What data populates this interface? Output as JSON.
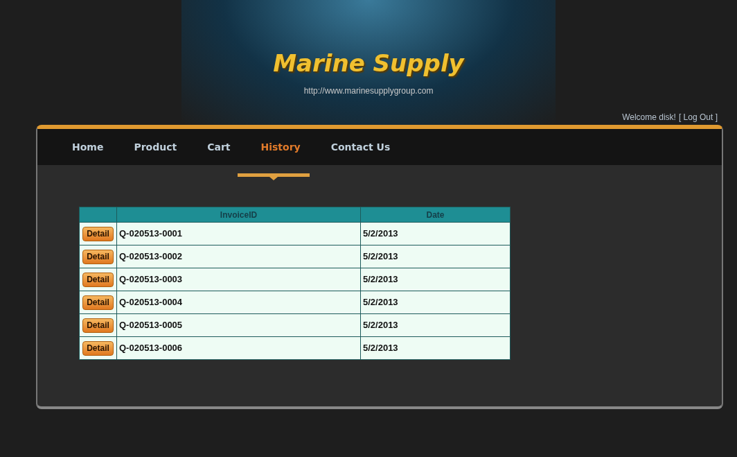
{
  "header": {
    "title": "Marine Supply",
    "url": "http://www.marinesupplygroup.com",
    "welcome": "Welcome disk!",
    "logout": "[ Log Out ]"
  },
  "nav": [
    {
      "label": "Home",
      "selected": false
    },
    {
      "label": "Product",
      "selected": false
    },
    {
      "label": "Cart",
      "selected": false
    },
    {
      "label": "History",
      "selected": true
    },
    {
      "label": "Contact Us",
      "selected": false
    }
  ],
  "table": {
    "columns": [
      "InvoiceID",
      "Date"
    ],
    "rows": [
      {
        "action": "Detail",
        "invoice": "Q-020513-0001",
        "date": "5/2/2013"
      },
      {
        "action": "Detail",
        "invoice": "Q-020513-0002",
        "date": "5/2/2013"
      },
      {
        "action": "Detail",
        "invoice": "Q-020513-0003",
        "date": "5/2/2013"
      },
      {
        "action": "Detail",
        "invoice": "Q-020513-0004",
        "date": "5/2/2013"
      },
      {
        "action": "Detail",
        "invoice": "Q-020513-0005",
        "date": "5/2/2013"
      },
      {
        "action": "Detail",
        "invoice": "Q-020513-0006",
        "date": "5/2/2013"
      }
    ]
  }
}
